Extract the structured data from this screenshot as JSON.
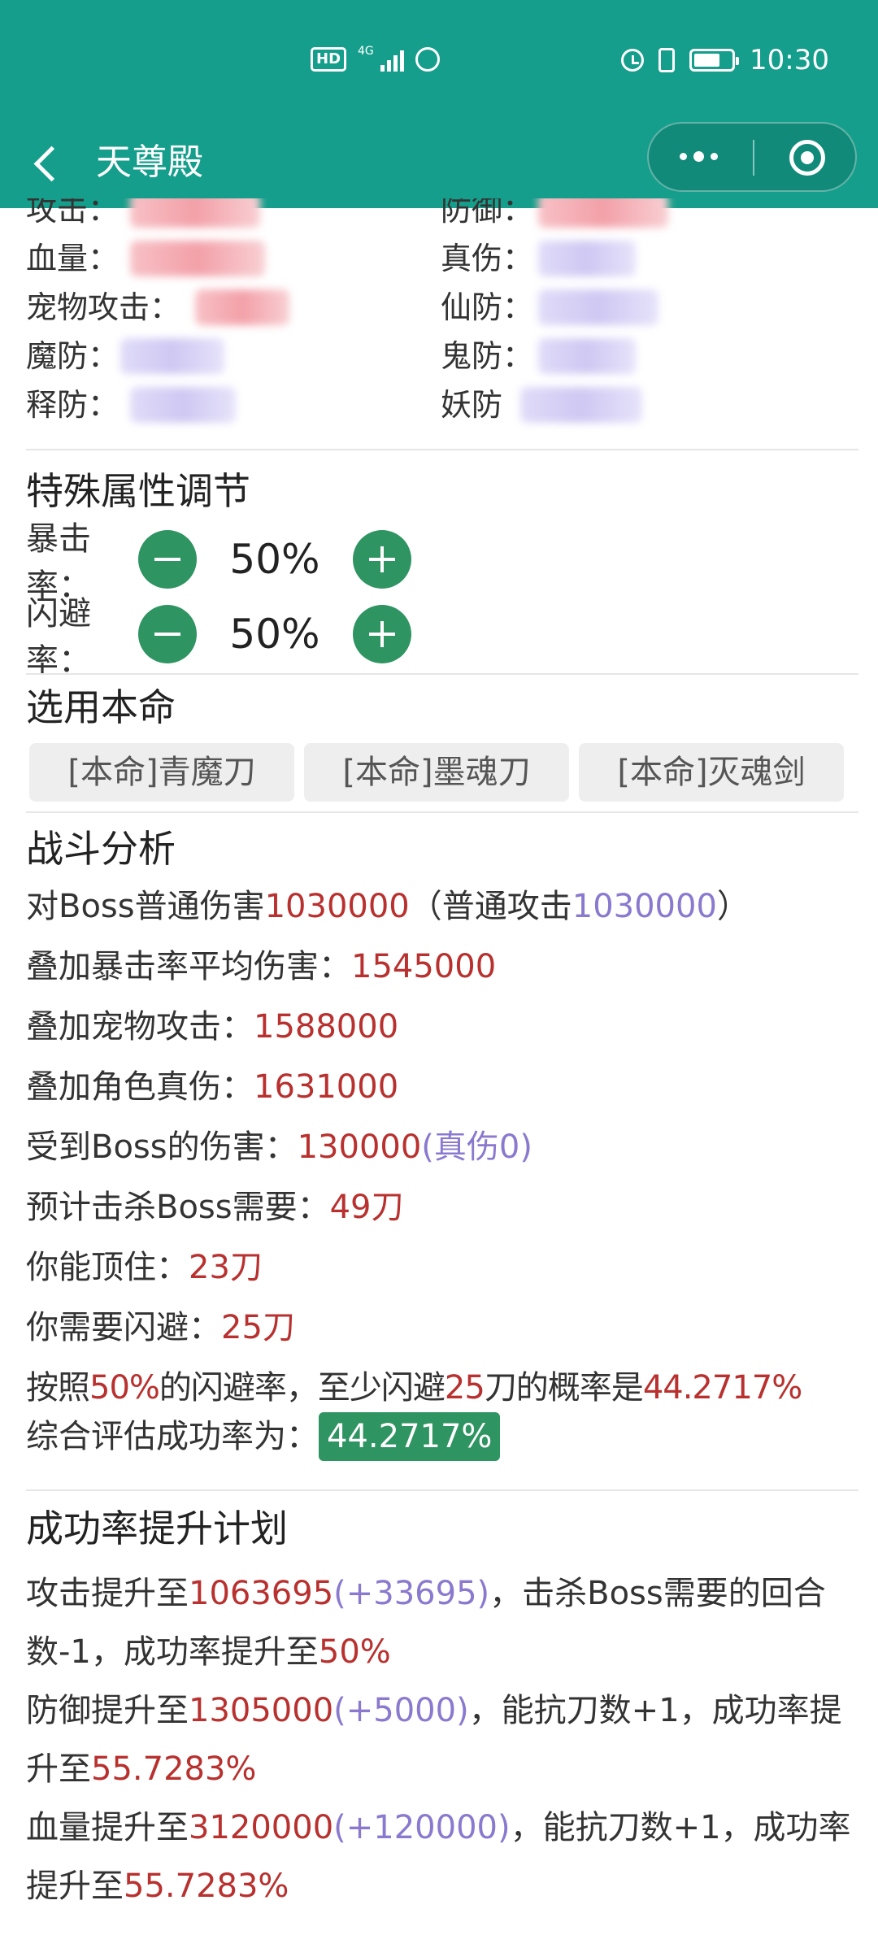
{
  "status_bar": {
    "hd": "HD",
    "network": "4G",
    "time": "10:30",
    "battery_level": 0.7,
    "icons": [
      "hd-icon",
      "signal-icon",
      "hand-icon",
      "alarm-icon",
      "vibrate-icon",
      "battery-icon"
    ]
  },
  "nav": {
    "title": "天尊殿",
    "back_icon": "chevron-left-icon",
    "menu_icon": "more-dots-icon",
    "close_icon": "target-icon"
  },
  "stats": {
    "attack": "攻击：",
    "defense": "防御：",
    "hp": "血量：",
    "true_damage": "真伤：",
    "pet_attack": "宠物攻击：",
    "immortal_def": "仙防：",
    "demon_def": "魔防：",
    "ghost_def": "鬼防：",
    "buddha_def": "释防：",
    "monster_def": "妖防"
  },
  "special": {
    "title": "特殊属性调节",
    "crit_label": "暴击率：",
    "crit_value": "50%",
    "dodge_label": "闪避率：",
    "dodge_value": "50%"
  },
  "weapons": {
    "title": "选用本命",
    "items": [
      "[本命]青魔刀",
      "[本命]墨魂刀",
      "[本命]灭魂剑"
    ]
  },
  "analysis": {
    "title": "战斗分析",
    "l1_a": "对Boss普通伤害",
    "l1_v": "1030000",
    "l1_b": "（普通攻击",
    "l1_v2": "1030000",
    "l1_c": "）",
    "l2_a": "叠加暴击率平均伤害：",
    "l2_v": "1545000",
    "l3_a": "叠加宠物攻击：",
    "l3_v": "1588000",
    "l4_a": "叠加角色真伤：",
    "l4_v": "1631000",
    "l5_a": "受到Boss的伤害：",
    "l5_v": "130000",
    "l5_v2": "(真伤0)",
    "l6_a": "预计击杀Boss需要：",
    "l6_v": "49刀",
    "l7_a": "你能顶住：",
    "l7_v": "23刀",
    "l8_a": "你需要闪避：",
    "l8_v": "25刀",
    "l9_a": "按照",
    "l9_v": "50%",
    "l9_b": "的闪避率，至少闪避",
    "l9_v2": "25",
    "l9_c": "刀的概率是",
    "l9_v3": "44.2717%",
    "l10_a": "综合评估成功率为：",
    "l10_v": "44.2717%"
  },
  "plan": {
    "title": "成功率提升计划",
    "p1_a": "攻击提升至",
    "p1_v": "1063695",
    "p1_d": "(+33695)",
    "p1_b": "，击杀Boss需要的回合数-1，成功率提升至",
    "p1_r": "50%",
    "p2_a": "防御提升至",
    "p2_v": "1305000",
    "p2_d": "(+5000)",
    "p2_b": "，能抗刀数+1，成功率提升至",
    "p2_r": "55.7283%",
    "p3_a": "血量提升至",
    "p3_v": "3120000",
    "p3_d": "(+120000)",
    "p3_b": "，能抗刀数+1，成功率提升至",
    "p3_r": "55.7283%"
  }
}
